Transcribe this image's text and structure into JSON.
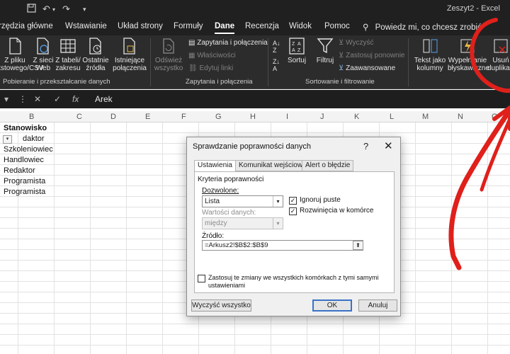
{
  "titlebar": {
    "save_icon": "save-icon",
    "undo_icon": "undo-icon",
    "redo_icon": "redo-icon",
    "title": "Zeszyt2 - Excel"
  },
  "tabs": [
    {
      "label": "rzędzia główne"
    },
    {
      "label": "Wstawianie"
    },
    {
      "label": "Układ strony"
    },
    {
      "label": "Formuły"
    },
    {
      "label": "Dane"
    },
    {
      "label": "Recenzja"
    },
    {
      "label": "Widok"
    },
    {
      "label": "Pomoc"
    }
  ],
  "search_label": "Powiedz mi, co chcesz zrobić",
  "ribbon": {
    "get_data": {
      "from_file_1": "Z pliku",
      "from_file_2": "kstowego/CSV",
      "from_web_1": "Z sieci",
      "from_web_2": "Web",
      "from_table_1": "Z tabeli/",
      "from_table_2": "zakresu",
      "recent_1": "Ostatnie",
      "recent_2": "źródła",
      "existing_1": "Istniejące",
      "existing_2": "połączenia",
      "group": "Pobieranie i przekształcanie danych"
    },
    "queries": {
      "refresh_1": "Odśwież",
      "refresh_2": "wszystko",
      "queries_connections": "Zapytania i połączenia",
      "properties": "Właściwości",
      "edit_links": "Edytuj linki",
      "group": "Zapytania i połączenia"
    },
    "sort": {
      "sort": "Sortuj",
      "filter": "Filtruj",
      "clear": "Wyczyść",
      "reapply": "Zastosuj ponownie",
      "advanced": "Zaawansowane",
      "group": "Sortowanie i filtrowanie"
    },
    "tools": {
      "text_to_columns_1": "Tekst jako",
      "text_to_columns_2": "kolumny",
      "flash_fill_1": "Wypełnianie",
      "flash_fill_2": "błyskawiczne",
      "remove_dup_1": "Usuń",
      "remove_dup_2": "duplikaty"
    }
  },
  "formula_bar": {
    "name_box_arrow": "▾",
    "cancel": "✕",
    "enter": "✓",
    "fx": "fx",
    "value": "Arek"
  },
  "columns": [
    "B",
    "C",
    "D",
    "E",
    "F",
    "G",
    "H",
    "I",
    "J",
    "K",
    "L",
    "M",
    "N",
    "O"
  ],
  "cells": {
    "header": "Stanowisko",
    "rows": [
      "daktor",
      "Szkoleniowiec",
      "Handlowiec",
      "Redaktor",
      "Programista",
      "Programista"
    ]
  },
  "dialog": {
    "title": "Sprawdzanie poprawności danych",
    "help": "?",
    "close": "✕",
    "tabs": [
      "Ustawienia",
      "Komunikat wejściowy",
      "Alert o błędzie"
    ],
    "criteria_label": "Kryteria poprawności",
    "allow_label": "Dozwolone:",
    "allow_value": "Lista",
    "data_label": "Wartości danych:",
    "data_value": "między",
    "ignore_blank": {
      "label": "Ignoruj puste",
      "checked": true
    },
    "in_cell_dropdown": {
      "label": "Rozwinięcia w komórce",
      "checked": true
    },
    "source_label": "Źródło:",
    "source_value": "=Arkusz2!$B$2:$B$9",
    "apply_all": {
      "label_1": "Zastosuj te zmiany we wszystkich komórkach z tymi samymi",
      "label_2": "ustawieniami",
      "checked": false
    },
    "clear_all": "Wyczyść wszystko",
    "ok": "OK",
    "cancel": "Anuluj"
  },
  "colors": {
    "ribbon_bg": "#2c2c2c",
    "titlebar_bg": "#202020",
    "annotation": "#e0201b"
  }
}
